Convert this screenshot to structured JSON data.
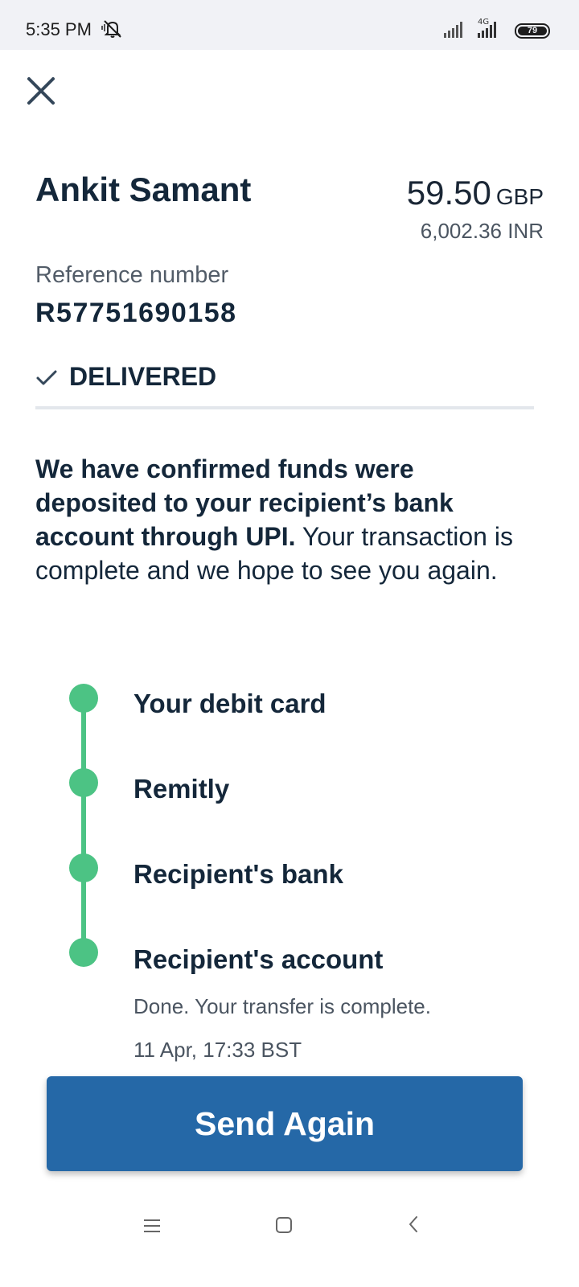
{
  "status_bar": {
    "time": "5:35 PM",
    "network": "4G",
    "battery": "79"
  },
  "header": {
    "close_icon": "close-icon"
  },
  "transfer": {
    "recipient_name": "Ankit Samant",
    "amount": "59.50",
    "currency": "GBP",
    "converted_amount": "6,002.36 INR",
    "reference_label": "Reference number",
    "reference_number": "R57751690158",
    "status": "DELIVERED"
  },
  "message": {
    "bold": "We have confirmed funds were deposited to your recipient’s bank account through UPI.",
    "normal": " Your transaction is complete and we hope to see you again."
  },
  "timeline": {
    "steps": [
      {
        "label": "Your debit card"
      },
      {
        "label": "Remitly"
      },
      {
        "label": "Recipient's bank"
      },
      {
        "label": "Recipient's account",
        "detail": "Done. Your transfer is complete.",
        "timestamp": "11 Apr, 17:33 BST"
      }
    ],
    "color": "#4cc384"
  },
  "actions": {
    "send_again": "Send Again",
    "button_color": "#2568a7"
  },
  "nav": {
    "menu_icon": "menu-icon",
    "home_icon": "home-icon",
    "back_icon": "back-icon"
  }
}
